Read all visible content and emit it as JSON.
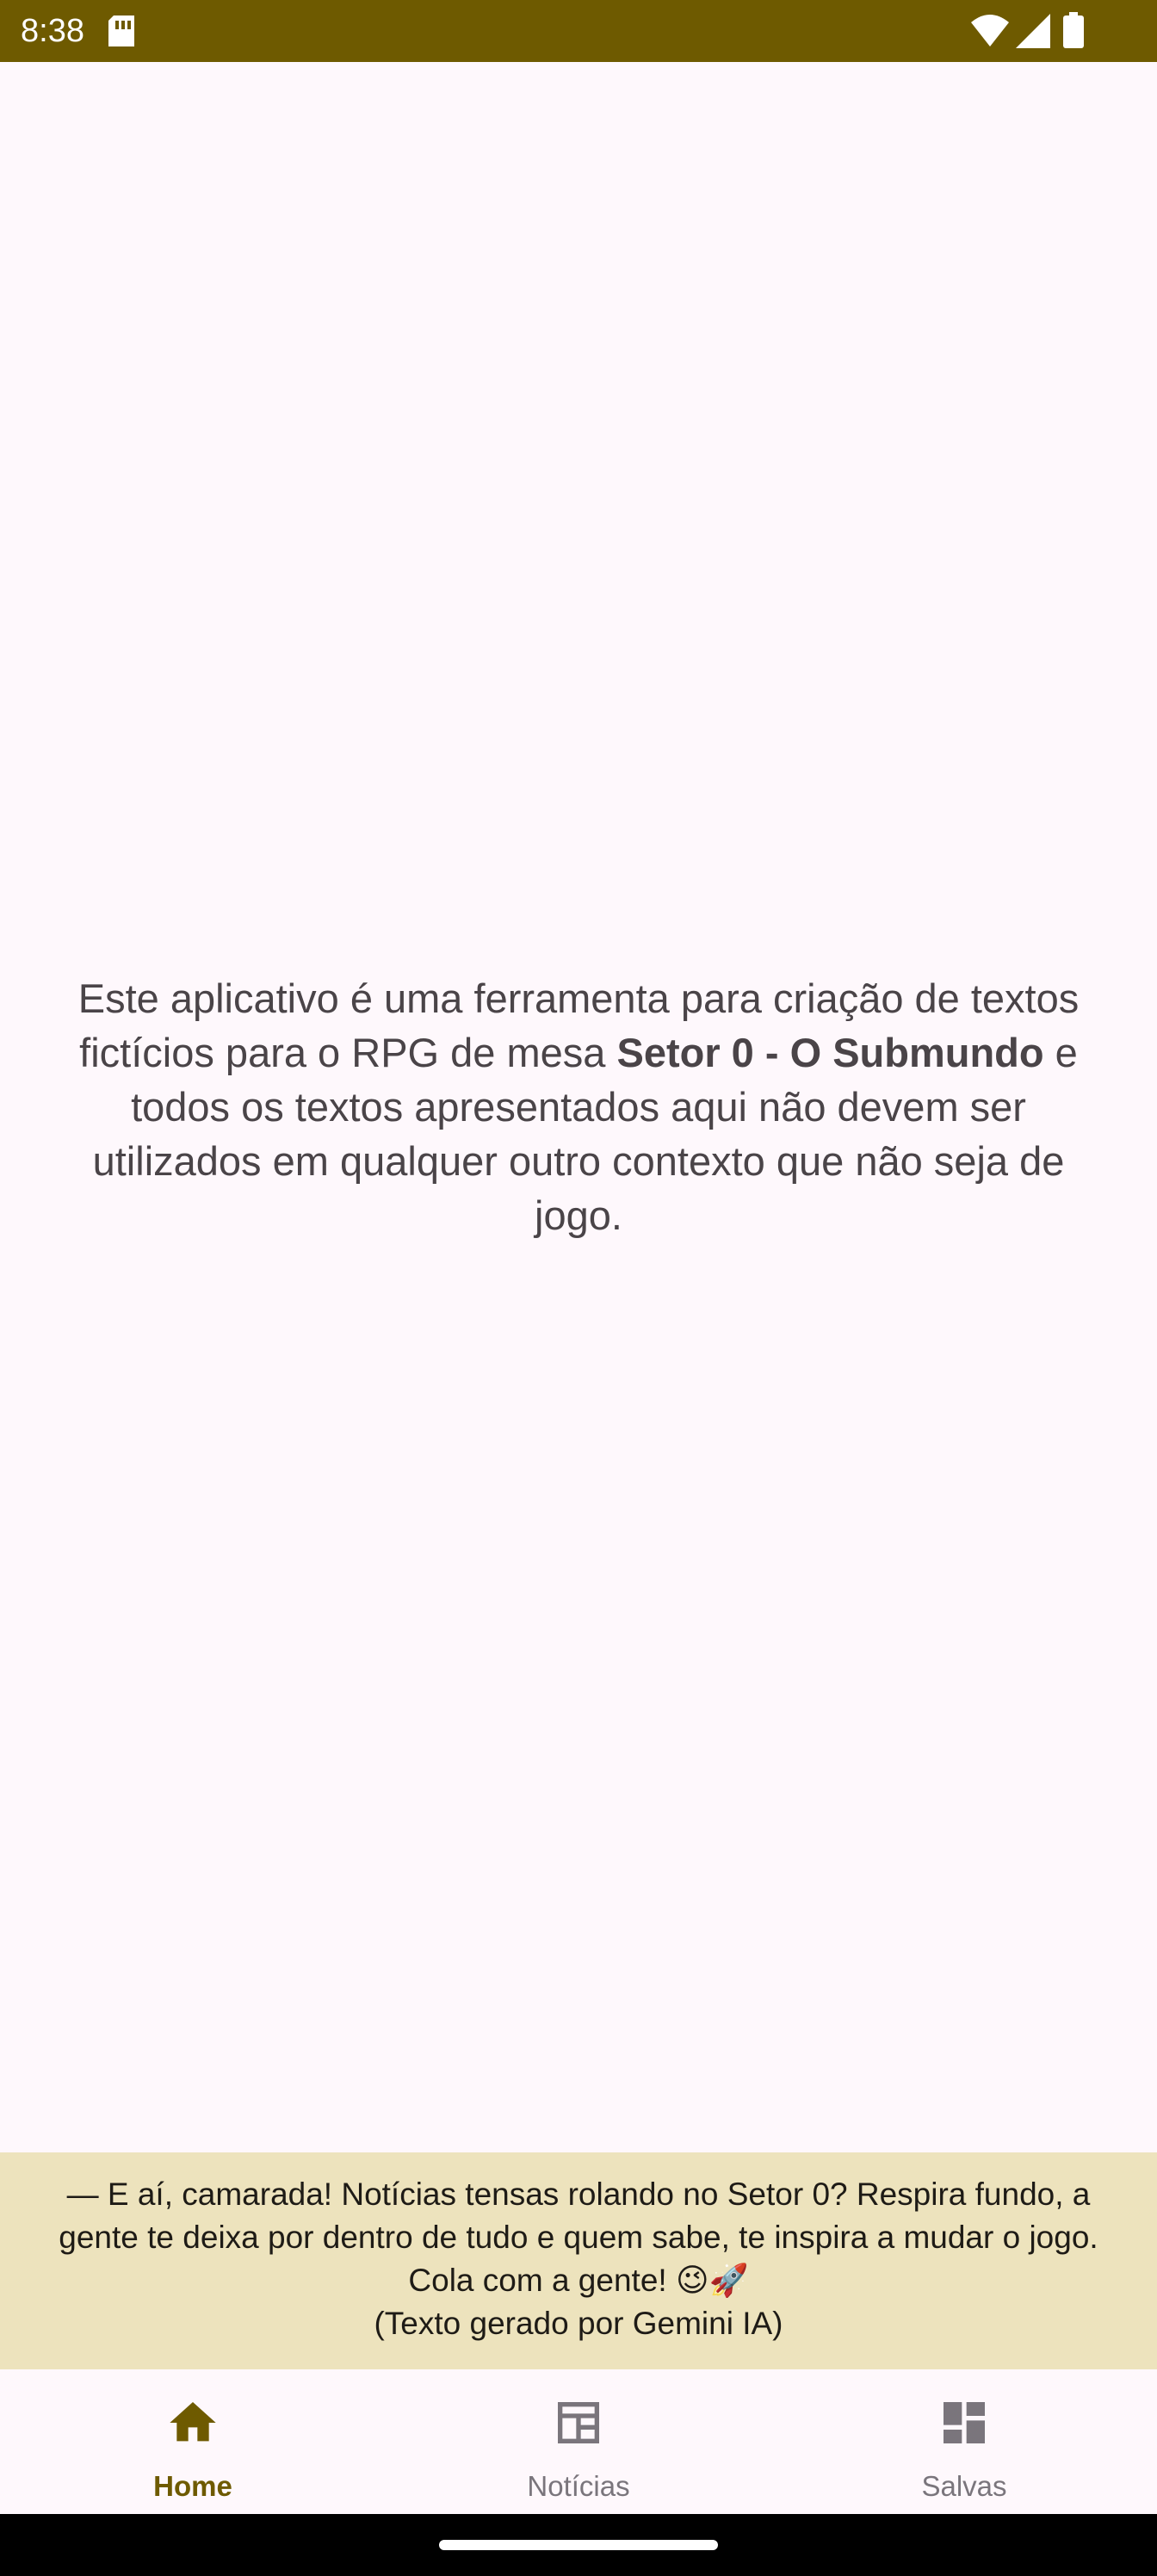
{
  "status_bar": {
    "time": "8:38",
    "icons": [
      "sim-card-icon",
      "wifi-icon",
      "signal-icon",
      "battery-icon"
    ],
    "background": "#6e5a00"
  },
  "disclaimer": {
    "text_before": "Este aplicativo é uma ferramenta para criação de textos fictícios para o RPG de mesa ",
    "bold": "Setor 0 - O Submundo",
    "text_after": " e todos os textos apresentados aqui não devem ser utilizados em qualquer outro contexto que não seja de jogo."
  },
  "banner": {
    "message": "— E aí, camarada! Notícias tensas rolando no Setor 0? Respira fundo, a gente te deixa por dentro de tudo e quem sabe, te inspira a mudar o jogo. Cola com a gente! 😉🚀",
    "credit": "(Texto gerado por Gemini IA)",
    "background": "#ede3bd"
  },
  "bottom_nav": {
    "items": [
      {
        "label": "Home",
        "icon": "home-icon",
        "active": true
      },
      {
        "label": "Notícias",
        "icon": "newspaper-icon",
        "active": false
      },
      {
        "label": "Salvas",
        "icon": "dashboard-icon",
        "active": false
      }
    ],
    "active_color": "#6e5a00",
    "inactive_color": "#7a757c"
  }
}
